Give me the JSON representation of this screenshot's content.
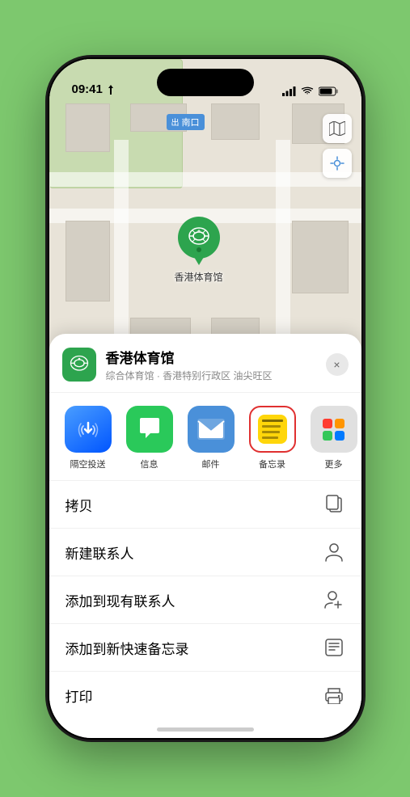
{
  "status_bar": {
    "time": "09:41",
    "location_icon": "▸"
  },
  "map": {
    "label": "南口",
    "venue_pin_label": "香港体育馆"
  },
  "sheet": {
    "venue_name": "香港体育馆",
    "venue_subtitle": "综合体育馆 · 香港特别行政区 油尖旺区",
    "close_label": "×"
  },
  "share_items": [
    {
      "id": "airdrop",
      "label": "隔空投送",
      "type": "airdrop"
    },
    {
      "id": "message",
      "label": "信息",
      "type": "message"
    },
    {
      "id": "mail",
      "label": "邮件",
      "type": "mail"
    },
    {
      "id": "notes",
      "label": "备忘录",
      "type": "notes"
    },
    {
      "id": "more",
      "label": "更多",
      "type": "more"
    }
  ],
  "actions": [
    {
      "id": "copy",
      "label": "拷贝",
      "icon": "copy"
    },
    {
      "id": "new-contact",
      "label": "新建联系人",
      "icon": "person"
    },
    {
      "id": "add-contact",
      "label": "添加到现有联系人",
      "icon": "person-add"
    },
    {
      "id": "quick-note",
      "label": "添加到新快速备忘录",
      "icon": "note"
    },
    {
      "id": "print",
      "label": "打印",
      "icon": "print"
    }
  ]
}
